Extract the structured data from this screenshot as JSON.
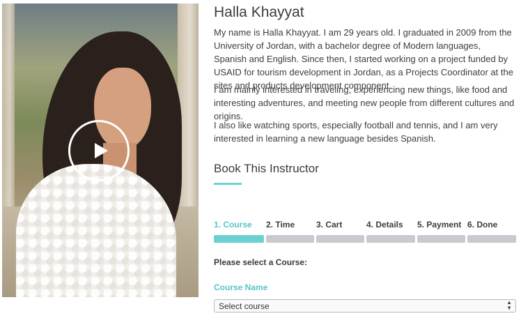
{
  "instructor": {
    "name": "Halla Khayyat",
    "bio": [
      "My name is Halla Khayyat. I am 29 years old. I graduated in 2009 from the University of Jordan, with a bachelor degree of Modern languages, Spanish and English. Since then, I started working on a project funded by USAID for tourism development in Jordan, as a Projects Coordinator at the sites and products development component.",
      "I am mainly interested in traveling, experiencing new things, like food and interesting adventures, and meeting new people from different cultures and origins.",
      "I also like watching sports, especially football and tennis, and I am very interested in learning a new language besides Spanish."
    ]
  },
  "booking": {
    "title": "Book This Instructor",
    "steps": [
      {
        "label": "1. Course",
        "active": true
      },
      {
        "label": "2. Time",
        "active": false
      },
      {
        "label": "3. Cart",
        "active": false
      },
      {
        "label": "4. Details",
        "active": false
      },
      {
        "label": "5. Payment",
        "active": false
      },
      {
        "label": "6. Done",
        "active": false
      }
    ],
    "prompt": "Please select a Course:",
    "course_field_label": "Course Name",
    "course_select_value": "Select course"
  },
  "media": {
    "play_icon": "play-icon"
  },
  "colors": {
    "accent": "#6ccfd0",
    "accent_text": "#56c4c8",
    "inactive_step": "#c9c9cf"
  }
}
